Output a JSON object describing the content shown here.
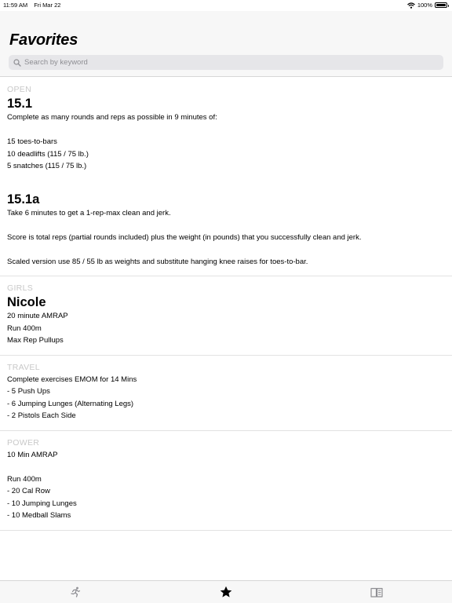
{
  "status_bar": {
    "time": "11:59 AM",
    "date": "Fri Mar 22",
    "battery_text": "100%",
    "battery_level": 1.0
  },
  "header": {
    "title": "Favorites",
    "search_placeholder": "Search by keyword"
  },
  "sections": {
    "open": {
      "header": "OPEN",
      "wods": [
        {
          "title": "15.1",
          "lines": [
            "Complete as many rounds and reps as possible in 9 minutes of:",
            "",
            "15 toes-to-bars",
            "10 deadlifts (115 / 75 lb.)",
            "5 snatches (115 / 75 lb.)"
          ]
        },
        {
          "title": "15.1a",
          "lines": [
            "Take 6 minutes to get a 1-rep-max clean and jerk.",
            "",
            "Score is total reps (partial rounds included) plus the weight (in pounds) that you successfully clean and jerk.",
            "",
            "Scaled version use 85 / 55 lb as weights and substitute hanging knee raises for toes-to-bar."
          ]
        }
      ]
    },
    "girls": {
      "header": "GIRLS",
      "wods": [
        {
          "title": "Nicole",
          "lines": [
            "20 minute AMRAP",
            "Run 400m",
            "Max Rep Pullups"
          ]
        }
      ]
    },
    "travel": {
      "header": "TRAVEL",
      "wods": [
        {
          "lines": [
            "Complete exercises EMOM for 14 Mins",
            "- 5 Push Ups",
            "- 6 Jumping Lunges (Alternating Legs)",
            "- 2 Pistols Each Side"
          ]
        }
      ]
    },
    "power": {
      "header": "POWER",
      "wods": [
        {
          "lines": [
            "10 Min AMRAP",
            "",
            "Run 400m",
            "- 20 Cal Row",
            "- 10 Jumping Lunges",
            "- 10 Medball Slams"
          ]
        }
      ]
    }
  },
  "tab_bar": {
    "tabs": [
      {
        "icon": "runner-icon",
        "selected": false
      },
      {
        "icon": "star-icon",
        "selected": true
      },
      {
        "icon": "book-icon",
        "selected": false
      }
    ]
  }
}
